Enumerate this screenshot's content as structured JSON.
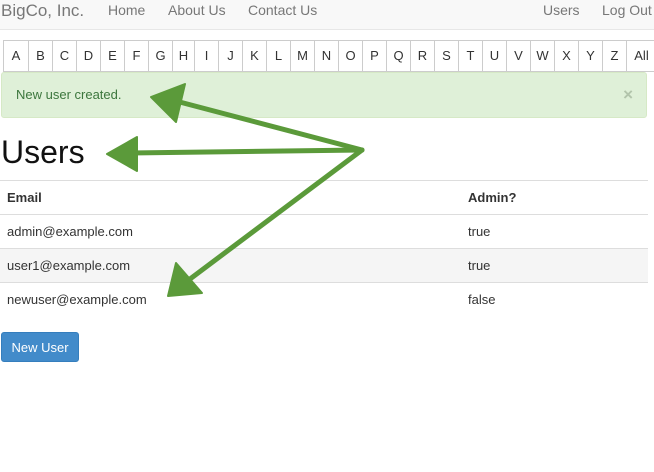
{
  "navbar": {
    "brand": "BigCo, Inc.",
    "links": [
      "Home",
      "About Us",
      "Contact Us"
    ],
    "right_links": [
      "Users",
      "Log Out"
    ]
  },
  "letters": [
    "A",
    "B",
    "C",
    "D",
    "E",
    "F",
    "G",
    "H",
    "I",
    "J",
    "K",
    "L",
    "M",
    "N",
    "O",
    "P",
    "Q",
    "R",
    "S",
    "T",
    "U",
    "V",
    "W",
    "X",
    "Y",
    "Z",
    "All"
  ],
  "alert": {
    "message": "New user created.",
    "close": "×",
    "color": "#dff0d8"
  },
  "page": {
    "title": "Users"
  },
  "table": {
    "headers": [
      "Email",
      "Admin?"
    ],
    "rows": [
      [
        "admin@example.com",
        "true"
      ],
      [
        "user1@example.com",
        "true"
      ],
      [
        "newuser@example.com",
        "false"
      ]
    ]
  },
  "new_user_button": {
    "label": "New User",
    "color": "#428bca"
  },
  "annotation": {
    "arrow_color": "#5b9a3a"
  }
}
